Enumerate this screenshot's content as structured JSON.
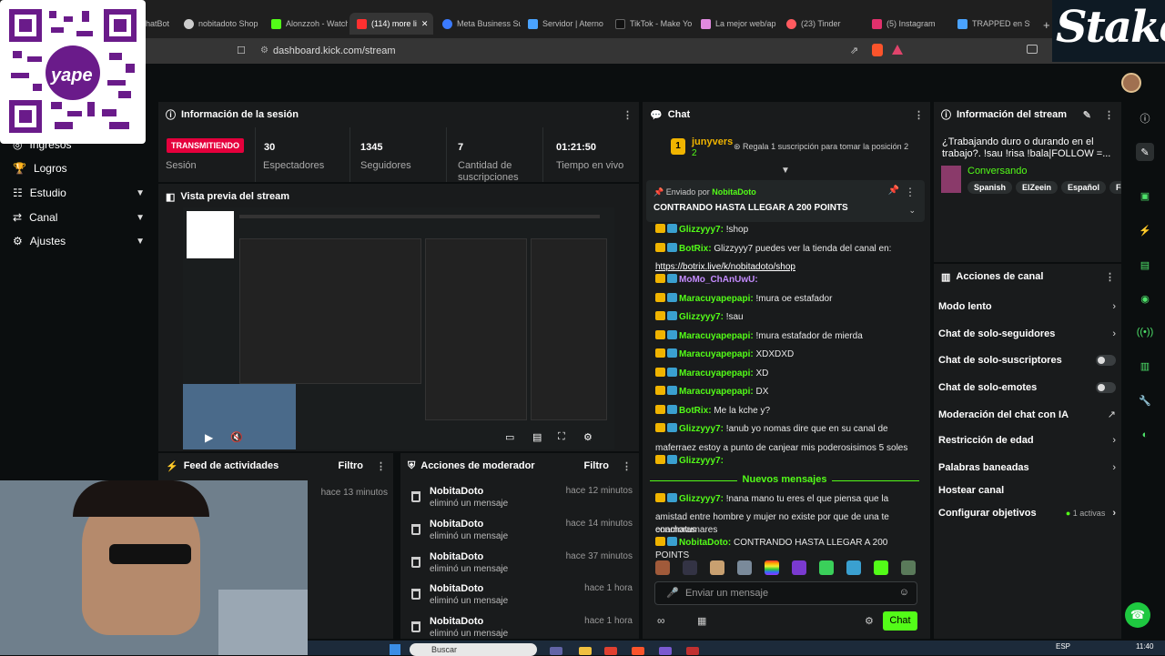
{
  "browser": {
    "tabs": [
      {
        "label": "hatBot",
        "color": "#4a4a4a"
      },
      {
        "label": "nobitadoto Shop",
        "color": "#cccccc"
      },
      {
        "label": "Alonzzoh - Watch",
        "color": "#53fc18"
      },
      {
        "label": "(114) more li",
        "color": "#ff3030"
      },
      {
        "label": "Meta Business Su",
        "color": "#3b7bff"
      },
      {
        "label": "Servidor | Aterno",
        "color": "#4aa3ff"
      },
      {
        "label": "TikTok - Make Yo",
        "color": "#111111"
      },
      {
        "label": "La mejor web/ap",
        "color": "#e18ae0"
      },
      {
        "label": "(23) Tinder",
        "color": "#ff5a5f"
      },
      {
        "label": "(5) Instagram",
        "color": "#e1306c"
      },
      {
        "label": "TRAPPED en Ste",
        "color": "#4aa3ff"
      }
    ],
    "url": "dashboard.kick.com/stream"
  },
  "overlay": {
    "yape_label": "yape",
    "stake_logo": "Stake"
  },
  "sidebar": {
    "items": [
      {
        "label": "Ingresos",
        "icon": "coins-icon"
      },
      {
        "label": "Logros",
        "icon": "trophy-icon"
      },
      {
        "label": "Estudio",
        "icon": "sliders-icon"
      },
      {
        "label": "Canal",
        "icon": "channel-icon"
      },
      {
        "label": "Ajustes",
        "icon": "gear-icon"
      }
    ]
  },
  "session": {
    "title": "Información de la sesión",
    "live_badge": "TRANSMITIENDO",
    "live_label": "Sesión",
    "stats": [
      {
        "value": "30",
        "label": "Espectadores"
      },
      {
        "value": "1345",
        "label": "Seguidores"
      },
      {
        "value": "7",
        "label": "Cantidad de suscripciones"
      },
      {
        "value": "01:21:50",
        "label": "Tiempo en vivo"
      }
    ]
  },
  "preview": {
    "title": "Vista previa del stream"
  },
  "activity": {
    "title": "Feed de actividades",
    "filter": "Filtro",
    "time": "hace 13 minutos"
  },
  "modactions": {
    "title": "Acciones de moderador",
    "filter": "Filtro",
    "rows": [
      {
        "user": "NobitaDoto",
        "action": "eliminó un mensaje",
        "time": "hace 12 minutos"
      },
      {
        "user": "NobitaDoto",
        "action": "eliminó un mensaje",
        "time": "hace 14 minutos"
      },
      {
        "user": "NobitaDoto",
        "action": "eliminó un mensaje",
        "time": "hace 37 minutos"
      },
      {
        "user": "NobitaDoto",
        "action": "eliminó un mensaje",
        "time": "hace 1 hora"
      },
      {
        "user": "NobitaDoto",
        "action": "eliminó un mensaje",
        "time": "hace 1 hora"
      }
    ]
  },
  "chat": {
    "title": "Chat",
    "top_user": "junyvers",
    "top_count": "2",
    "top_rank": "1",
    "gift_text": "Regala 1 suscripción para tomar la posición 2",
    "pinned_by": "Enviado por",
    "pinned_user": "NobitaDoto",
    "pinned_text": "CONTRANDO HASTA LLEGAR A 200 POINTS",
    "messages": [
      {
        "user": "Glizzyyy7:",
        "text": "!shop",
        "color": "#53fc18"
      },
      {
        "user": "BotRix:",
        "text": "Glizzyyy7 puedes ver la tienda del canal en:",
        "color": "#53fc18"
      },
      {
        "user": "",
        "text": "https://botrix.live/k/nobitadoto/shop",
        "color": "#ffffff"
      },
      {
        "user": "MoMo_ChAnUwU:",
        "text": "",
        "color": "#c58cff"
      },
      {
        "user": "Maracuyapepapi:",
        "text": "!mura oe estafador",
        "color": "#53fc18"
      },
      {
        "user": "Glizzyyy7:",
        "text": "!sau",
        "color": "#53fc18"
      },
      {
        "user": "Maracuyapepapi:",
        "text": "!mura estafador de mierda",
        "color": "#53fc18"
      },
      {
        "user": "Maracuyapepapi:",
        "text": "XDXDXD",
        "color": "#53fc18"
      },
      {
        "user": "Maracuyapepapi:",
        "text": "XD",
        "color": "#53fc18"
      },
      {
        "user": "Maracuyapepapi:",
        "text": "DX",
        "color": "#53fc18"
      },
      {
        "user": "BotRix:",
        "text": "Me la kche y?",
        "color": "#53fc18"
      },
      {
        "user": "Glizzyyy7:",
        "text": "!anub yo nomas dire que en su canal de",
        "color": "#53fc18"
      },
      {
        "user": "",
        "text": "maferraez estoy a punto de canjear mis poderosisimos 5 soles",
        "color": "#e8e8e8"
      },
      {
        "user": "Glizzyyy7:",
        "text": "",
        "color": "#53fc18"
      }
    ],
    "new_messages": "Nuevos mensajes",
    "messages2": [
      {
        "user": "Glizzyyy7:",
        "text": "!nana mano tu eres el que piensa que la",
        "color": "#53fc18"
      },
      {
        "user": "",
        "text": "amistad entre hombre y mujer no existe por que de una te enamoras",
        "color": "#e8e8e8"
      },
      {
        "user": "",
        "text": "conchatumares",
        "color": "#e8e8e8"
      },
      {
        "user": "NobitaDoto:",
        "text": "CONTRANDO HASTA LLEGAR A 200 POINTS",
        "color": "#53fc18"
      }
    ],
    "placeholder": "Enviar un mensaje",
    "send": "Chat"
  },
  "streaminfo": {
    "title": "Información del stream",
    "stream_title": "¿Trabajando duro o durando en el trabajo?. !sau !risa !bala|FOLLOW =...",
    "category": "Conversando",
    "tags": [
      "Spanish",
      "ElZeein",
      "Español",
      "Feka"
    ]
  },
  "channel_actions": {
    "title": "Acciones de canal",
    "items": [
      {
        "label": "Modo lento",
        "right": "chevron"
      },
      {
        "label": "Chat de solo-seguidores",
        "right": "chevron"
      },
      {
        "label": "Chat de solo-suscriptores",
        "right": "toggle"
      },
      {
        "label": "Chat de solo-emotes",
        "right": "toggle"
      },
      {
        "label": "Moderación del chat con IA",
        "right": "external"
      },
      {
        "label": "Restricción de edad",
        "right": "chevron"
      },
      {
        "label": "Palabras baneadas",
        "right": "chevron"
      },
      {
        "label": "Hostear canal",
        "right": "none"
      },
      {
        "label": "Configurar objetivos",
        "right": "chevron"
      }
    ],
    "goals_status": "1 activas"
  },
  "taskbar": {
    "search": "Buscar",
    "lang": "ESP",
    "time": "11:40"
  },
  "colors": {
    "accent": "#53fc18",
    "live": "#e5003c",
    "panel": "#191b1c",
    "bg": "#0b0e0f"
  }
}
